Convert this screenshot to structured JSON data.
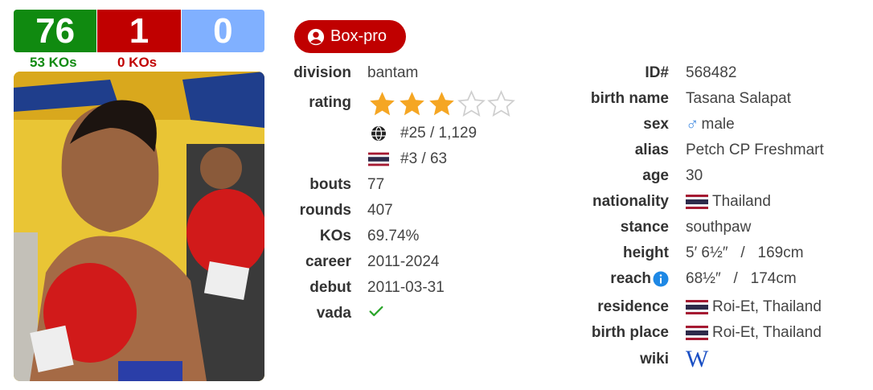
{
  "record": {
    "wins": "76",
    "losses": "1",
    "draws": "0",
    "win_kos": "53 KOs",
    "loss_kos": "0 KOs"
  },
  "category": {
    "label": "Box-pro"
  },
  "left": {
    "division": {
      "label": "division",
      "value": "bantam"
    },
    "rating": {
      "label": "rating",
      "stars": 3,
      "max_stars": 5
    },
    "world_rank": "#25 / 1,129",
    "country_rank": "#3 / 63",
    "bouts": {
      "label": "bouts",
      "value": "77"
    },
    "rounds": {
      "label": "rounds",
      "value": "407"
    },
    "kos": {
      "label": "KOs",
      "value": "69.74%"
    },
    "career": {
      "label": "career",
      "value": "2011-2024"
    },
    "debut": {
      "label": "debut",
      "value": "2011-03-31"
    },
    "vada": {
      "label": "vada"
    }
  },
  "right": {
    "id": {
      "label": "ID#",
      "value": "568482"
    },
    "birth_name": {
      "label": "birth name",
      "value": "Tasana Salapat"
    },
    "sex": {
      "label": "sex",
      "value": "male"
    },
    "alias": {
      "label": "alias",
      "value": "Petch CP Freshmart"
    },
    "age": {
      "label": "age",
      "value": "30"
    },
    "nationality": {
      "label": "nationality",
      "value": "Thailand"
    },
    "stance": {
      "label": "stance",
      "value": "southpaw"
    },
    "height": {
      "label": "height",
      "value": "5′ 6½″   /   169cm"
    },
    "reach": {
      "label": "reach",
      "value": "68½″   /   174cm"
    },
    "residence": {
      "label": "residence",
      "value": "Roi-Et, Thailand"
    },
    "birth_place": {
      "label": "birth place",
      "value": "Roi-Et, Thailand"
    },
    "wiki": {
      "label": "wiki",
      "value": "W"
    }
  },
  "colors": {
    "win": "#108a10",
    "loss": "#c00000",
    "draw": "#80b0ff",
    "star": "#f5a623"
  },
  "icons": [
    "user-circle-icon",
    "globe-icon",
    "thailand-flag-icon",
    "check-icon",
    "male-icon",
    "info-icon",
    "wikipedia-icon"
  ]
}
